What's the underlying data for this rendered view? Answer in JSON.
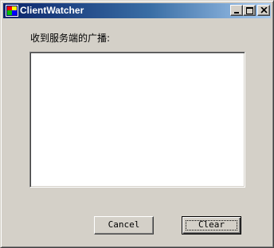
{
  "window": {
    "title": "ClientWatcher",
    "icon": "app-icon",
    "controls": {
      "minimize": "minimize-icon",
      "maximize": "maximize-icon",
      "close": "close-icon"
    }
  },
  "main": {
    "label": "收到服务端的广播:",
    "broadcast_text": ""
  },
  "buttons": {
    "cancel_label": "Cancel",
    "clear_label": "Clear"
  },
  "colors": {
    "titlebar_start": "#0a246a",
    "titlebar_end": "#a6caf0",
    "window_bg": "#d4d0c8",
    "textbox_bg": "#ffffff"
  }
}
